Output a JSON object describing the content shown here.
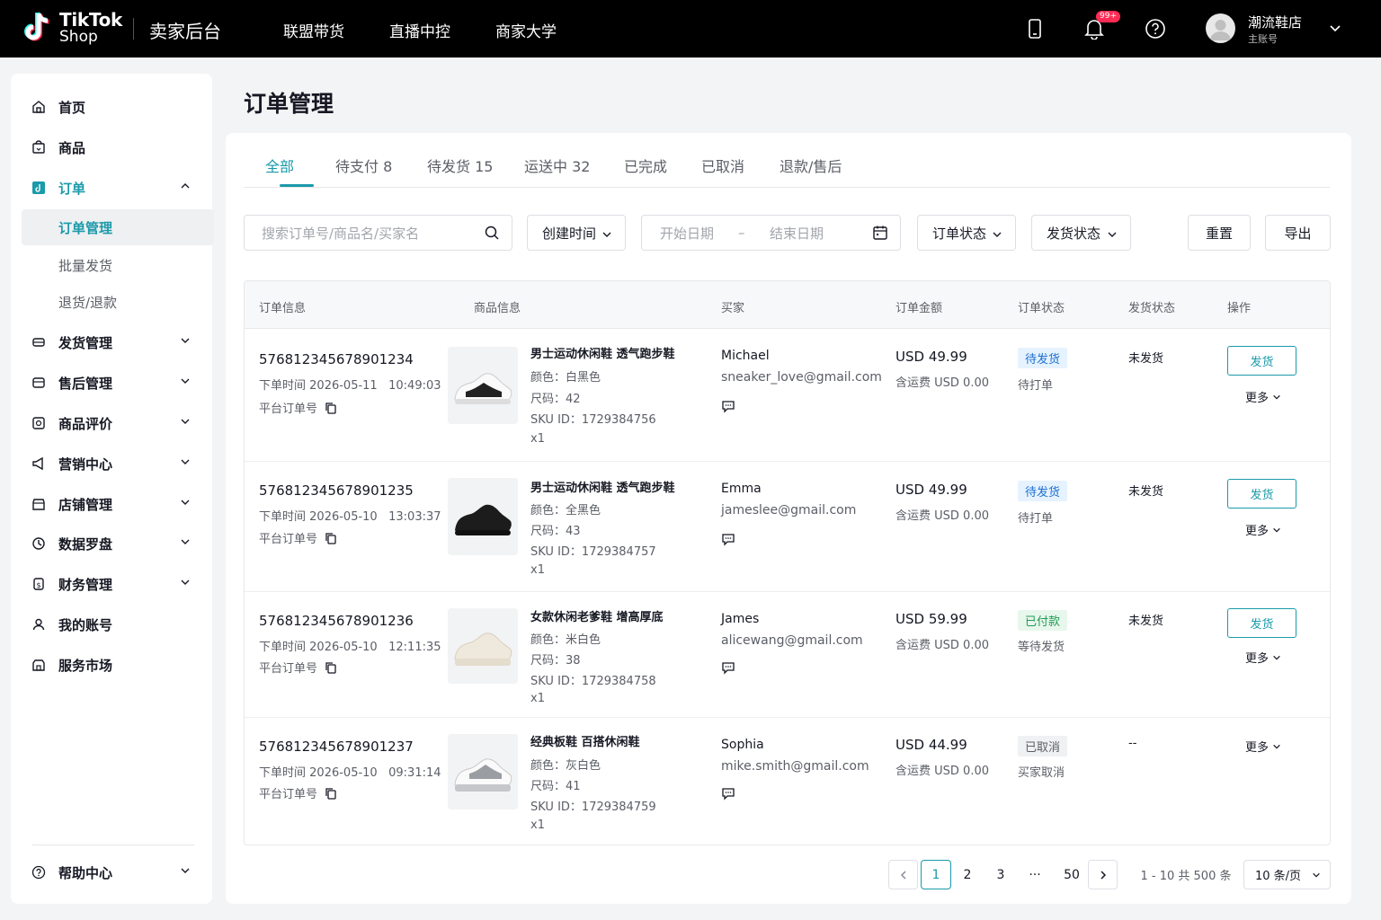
{
  "header": {
    "brand_line1": "TikTok",
    "brand_line2": "Shop",
    "console_title": "卖家后台",
    "nav": [
      "联盟带货",
      "直播中控",
      "商家大学"
    ],
    "notification_badge": "99+",
    "user_name": "潮流鞋店",
    "user_role": "主账号"
  },
  "sidebar": {
    "items": [
      {
        "label": "首页"
      },
      {
        "label": "商品"
      },
      {
        "label": "订单"
      },
      {
        "label": "发货管理"
      },
      {
        "label": "售后管理"
      },
      {
        "label": "商品评价"
      },
      {
        "label": "营销中心"
      },
      {
        "label": "店铺管理"
      },
      {
        "label": "数据罗盘"
      },
      {
        "label": "财务管理"
      },
      {
        "label": "我的账号"
      },
      {
        "label": "服务市场"
      }
    ],
    "sub_items": [
      {
        "label": "订单管理"
      },
      {
        "label": "批量发货"
      },
      {
        "label": "退货/退款"
      }
    ],
    "help": "帮助中心"
  },
  "page": {
    "title": "订单管理",
    "tabs": [
      "全部",
      "待支付 8",
      "待发货 15",
      "运送中 32",
      "已完成",
      "已取消",
      "退款/售后"
    ],
    "filters": {
      "search_placeholder": "搜索订单号/商品名/买家名",
      "time_select": "创建时间",
      "start_date": "开始日期",
      "date_sep": "–",
      "end_date": "结束日期",
      "order_status": "订单状态",
      "ship_status": "发货状态",
      "reset": "重置",
      "export": "导出"
    },
    "columns": [
      "订单信息",
      "商品信息",
      "买家",
      "订单金额",
      "订单状态",
      "发货状态",
      "操作"
    ],
    "orders": [
      {
        "order_no": "576812345678901234",
        "time_label": "下单时间",
        "date": "2026-05-11",
        "time": "10:49:03",
        "platform_label": "平台订单号",
        "product_name": "男士运动休闲鞋 透气跑步鞋",
        "color": "颜色：白黑色",
        "size": "尺码：42",
        "sku": "SKU ID：1729384756",
        "qty": "x1",
        "buyer": "Michael",
        "email": "sneaker_love@gmail.com",
        "amount": "USD 49.99",
        "shipping": "含运费  USD 0.00",
        "status": "待发货",
        "status_sub": "待打单",
        "ship_status": "未发货",
        "action": "发货",
        "more": "更多"
      },
      {
        "order_no": "576812345678901235",
        "time_label": "下单时间",
        "date": "2026-05-10",
        "time": "13:03:37",
        "platform_label": "平台订单号",
        "product_name": "男士运动休闲鞋 透气跑步鞋",
        "color": "颜色：全黑色",
        "size": "尺码：43",
        "sku": "SKU ID：1729384757",
        "qty": "x1",
        "buyer": "Emma",
        "email": "jameslee@gmail.com",
        "amount": "USD 49.99",
        "shipping": "含运费  USD 0.00",
        "status": "待发货",
        "status_sub": "待打单",
        "ship_status": "未发货",
        "action": "发货",
        "more": "更多"
      },
      {
        "order_no": "576812345678901236",
        "time_label": "下单时间",
        "date": "2026-05-10",
        "time": "12:11:35",
        "platform_label": "平台订单号",
        "product_name": "女款休闲老爹鞋 增高厚底",
        "color": "颜色：米白色",
        "size": "尺码：38",
        "sku": "SKU ID：1729384758",
        "qty": "x1",
        "buyer": "James",
        "email": "alicewang@gmail.com",
        "amount": "USD 59.99",
        "shipping": "含运费  USD 0.00",
        "status": "已付款",
        "status_sub": "等待发货",
        "ship_status": "未发货",
        "action": "发货",
        "more": "更多"
      },
      {
        "order_no": "576812345678901237",
        "time_label": "下单时间",
        "date": "2026-05-10",
        "time": "09:31:14",
        "platform_label": "平台订单号",
        "product_name": "经典板鞋 百搭休闲鞋",
        "color": "颜色：灰白色",
        "size": "尺码：41",
        "sku": "SKU ID：1729384759",
        "qty": "x1",
        "buyer": "Sophia",
        "email": "mike.smith@gmail.com",
        "amount": "USD 44.99",
        "shipping": "含运费  USD 0.00",
        "status": "已取消",
        "status_sub": "买家取消",
        "ship_status": "--",
        "action": "",
        "more": "更多"
      }
    ],
    "pagination": {
      "pages": [
        "1",
        "2",
        "3",
        "···",
        "50"
      ],
      "summary": "1 - 10 共 500 条",
      "page_size": "10 条/页"
    }
  },
  "colors": {
    "accent": "#1b9aaa",
    "topbar": "#000000",
    "badge_red": "#fe2c55"
  },
  "icons": [
    "tiktok-logo-icon",
    "phone-icon",
    "bell-icon",
    "help-circle-icon",
    "chevron-down-icon",
    "home-icon",
    "product-icon",
    "order-icon",
    "truck-icon",
    "aftersale-icon",
    "review-icon",
    "marketing-icon",
    "store-icon",
    "data-icon",
    "finance-icon",
    "user-icon",
    "service-icon",
    "search-icon",
    "calendar-icon",
    "copy-icon",
    "chat-icon",
    "chevron-left-icon",
    "chevron-right-icon"
  ]
}
